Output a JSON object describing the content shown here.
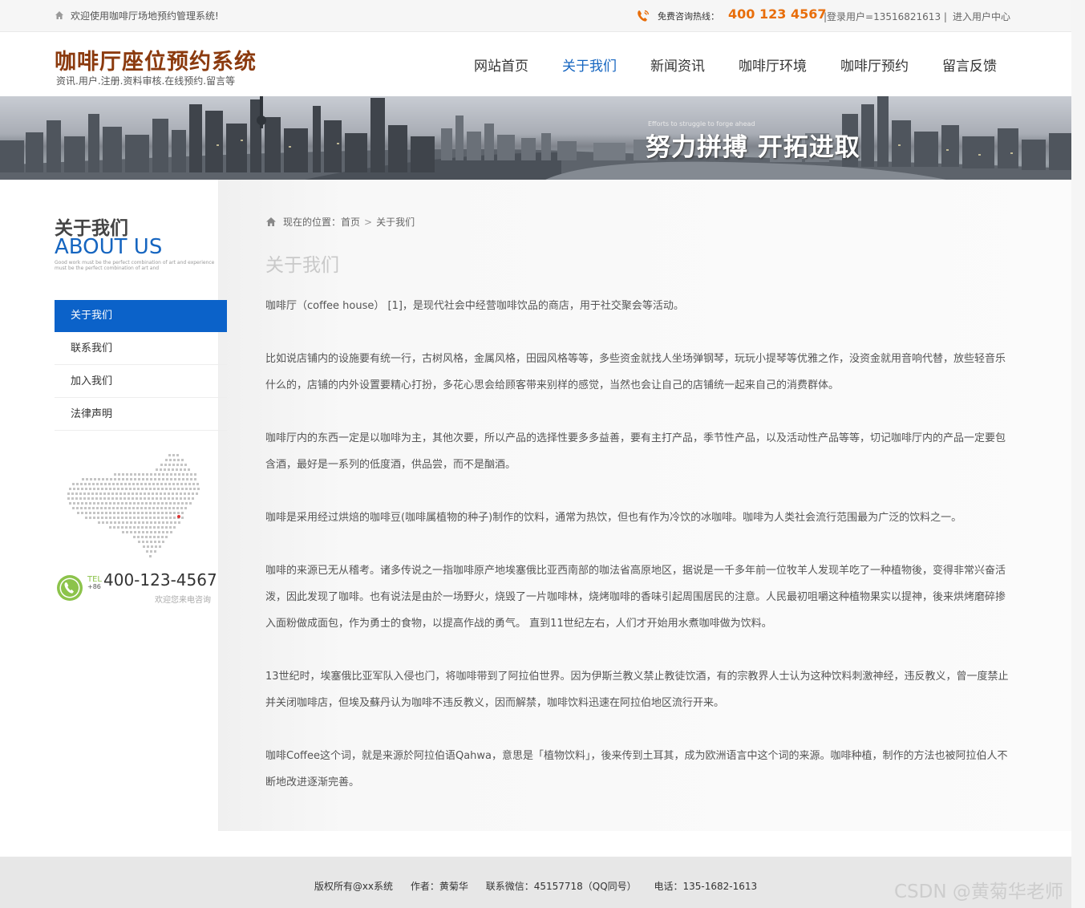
{
  "topbar": {
    "welcome": "欢迎使用咖啡厅场地预约管理系统!",
    "hotline_label": "免费咨询热线：",
    "hotline_number": "400 123 4567",
    "login_text": "|登录用户=13516821613 |",
    "user_center": "进入用户中心"
  },
  "header": {
    "title": "咖啡厅座位预约系统",
    "subtitle": "资讯.用户.注册.资料审核.在线预约.留言等",
    "nav": [
      "网站首页",
      "关于我们",
      "新闻资讯",
      "咖啡厅环境",
      "咖啡厅预约",
      "留言反馈"
    ],
    "active_nav": "关于我们",
    "accent_color": "#1565c0",
    "brand_color": "#8b3a0e"
  },
  "banner": {
    "slogan_en": "Efforts to struggle to forge ahead",
    "slogan_cn": "努力拼搏 开拓进取"
  },
  "sidebar": {
    "title_cn": "关于我们",
    "title_en": "ABOUT US",
    "title_small_1": "Good work must be the perfect combination of art and experience",
    "title_small_2": "must be the perfect combination of art and",
    "menu": [
      "关于我们",
      "联系我们",
      "加入我们",
      "法律声明"
    ],
    "active_menu": "关于我们",
    "tel_label": "TEL",
    "tel_cc": "+86",
    "tel_number": "400-123-4567",
    "tel_sub": "欢迎您来电咨询"
  },
  "content": {
    "crumb_label": "现在的位置：",
    "crumb_home": "首页",
    "crumb_sep": ">",
    "crumb_current": "关于我们",
    "title": "关于我们",
    "paragraphs": [
      "咖啡厅（coffee house） [1]，是现代社会中经营咖啡饮品的商店，用于社交聚会等活动。",
      "比如说店铺内的设施要有统一行，古树风格，金属风格，田园风格等等，多些资金就找人坐场弹钢琴，玩玩小提琴等优雅之作，没资金就用音响代替，放些轻音乐什么的，店铺的内外设置要精心打扮，多花心思会给顾客带来别样的感觉，当然也会让自己的店铺统一起来自己的消费群体。",
      "咖啡厅内的东西一定是以咖啡为主，其他次要，所以产品的选择性要多多益善，要有主打产品，季节性产品，以及活动性产品等等，切记咖啡厅内的产品一定要包含酒，最好是一系列的低度酒，供品尝，而不是酗酒。",
      "咖啡是采用经过烘焙的咖啡豆(咖啡属植物的种子)制作的饮料，通常为热饮，但也有作为冷饮的冰咖啡。咖啡为人类社会流行范围最为广泛的饮料之一。",
      "咖啡的来源已无从稽考。诸多传说之一指咖啡原产地埃塞俄比亚西南部的咖法省高原地区，据说是一千多年前一位牧羊人发现羊吃了一种植物後，变得非常兴奋活泼，因此发现了咖啡。也有说法是由於一场野火，烧毁了一片咖啡林，烧烤咖啡的香味引起周围居民的注意。人民最初咀嚼这种植物果实以提神，後来烘烤磨碎掺入面粉做成面包，作为勇士的食物，以提高作战的勇气。 直到11世纪左右，人们才开始用水煮咖啡做为饮料。",
      "13世纪时，埃塞俄比亚军队入侵也门，将咖啡带到了阿拉伯世界。因为伊斯兰教义禁止教徒饮酒，有的宗教界人士认为这种饮料刺激神经，违反教义，曾一度禁止并关闭咖啡店，但埃及蘇丹认为咖啡不违反教义，因而解禁，咖啡饮料迅速在阿拉伯地区流行开来。",
      "咖啡Coffee这个词，就是来源於阿拉伯语Qahwa，意思是「植物饮料」，後来传到土耳其，成为欧洲语言中这个词的来源。咖啡种植，制作的方法也被阿拉伯人不断地改进逐渐完善。"
    ]
  },
  "footer": {
    "copyright": "版权所有@xx系统",
    "author": "作者：黄菊华",
    "wechat": "联系微信：45157718（QQ同号）",
    "phone": "电话：135-1682-1613"
  },
  "watermark": "CSDN @黄菊华老师"
}
